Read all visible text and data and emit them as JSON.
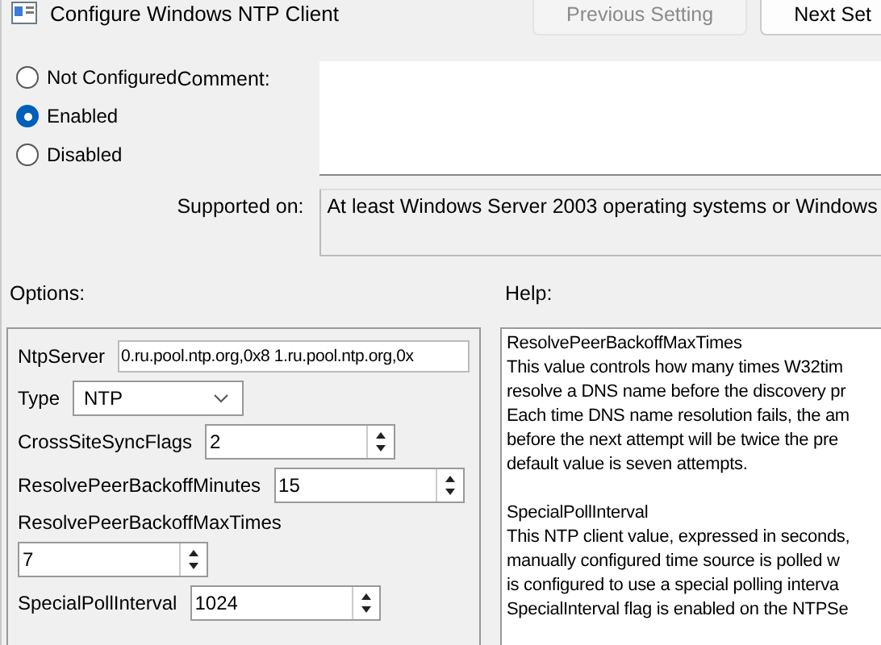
{
  "window": {
    "title": "Configure Windows NTP Client"
  },
  "nav_buttons": [
    {
      "label": "Previous Setting",
      "disabled": true
    },
    {
      "label": "Next Set",
      "disabled": false
    }
  ],
  "state_options": [
    {
      "label": "Not Configured",
      "selected": false
    },
    {
      "label": "Enabled",
      "selected": true
    },
    {
      "label": "Disabled",
      "selected": false
    }
  ],
  "comment": {
    "label": "Comment:"
  },
  "supported_on": {
    "label": "Supported on:",
    "value": "At least Windows Server 2003 operating systems or Windows"
  },
  "options": {
    "label": "Options:",
    "fields": [
      {
        "kind": "text",
        "label": "NtpServer",
        "value": "0.ru.pool.ntp.org,0x8 1.ru.pool.ntp.org,0x"
      },
      {
        "kind": "select",
        "label": "Type",
        "value": "NTP"
      },
      {
        "kind": "spin",
        "label": "CrossSiteSyncFlags",
        "value": "2"
      },
      {
        "kind": "spin",
        "label": "ResolvePeerBackoffMinutes",
        "value": "15"
      },
      {
        "kind": "spin-below",
        "label": "ResolvePeerBackoffMaxTimes",
        "value": "7"
      },
      {
        "kind": "spin",
        "label": "SpecialPollInterval",
        "value": "1024"
      }
    ]
  },
  "help": {
    "label": "Help:",
    "paragraphs": [
      [
        "ResolvePeerBackoffMaxTimes",
        "This value controls how many times W32tim",
        "resolve a DNS name before the discovery pr",
        "Each time DNS name resolution fails, the am",
        "before the next attempt will be twice the pre",
        "default value is seven attempts."
      ],
      [
        "SpecialPollInterval",
        "This NTP client value, expressed in seconds,",
        "manually configured time source is polled w",
        "is configured to use a special polling interva",
        "SpecialInterval flag is enabled on the NTPSe"
      ]
    ]
  }
}
